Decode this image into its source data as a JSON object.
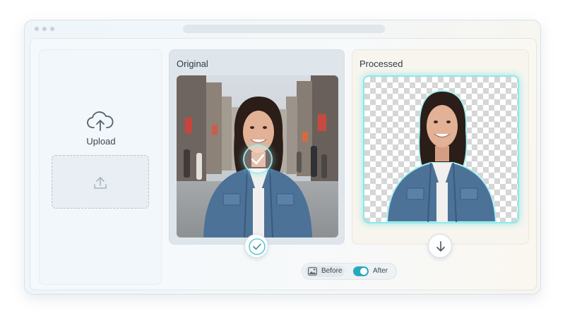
{
  "upload": {
    "label": "Upload"
  },
  "original": {
    "title": "Original"
  },
  "processed": {
    "title": "Processed"
  },
  "toggle": {
    "before_label": "Before",
    "after_label": "After",
    "after_enabled": true
  },
  "icons": {
    "upload_cloud": "cloud-upload-icon",
    "dropzone": "upload-arrow-icon",
    "check": "check-icon",
    "confirm": "check-circle-icon",
    "download": "download-arrow-icon",
    "before": "image-icon"
  },
  "colors": {
    "accent": "#27a9bd",
    "glow": "#8fe8ea"
  }
}
